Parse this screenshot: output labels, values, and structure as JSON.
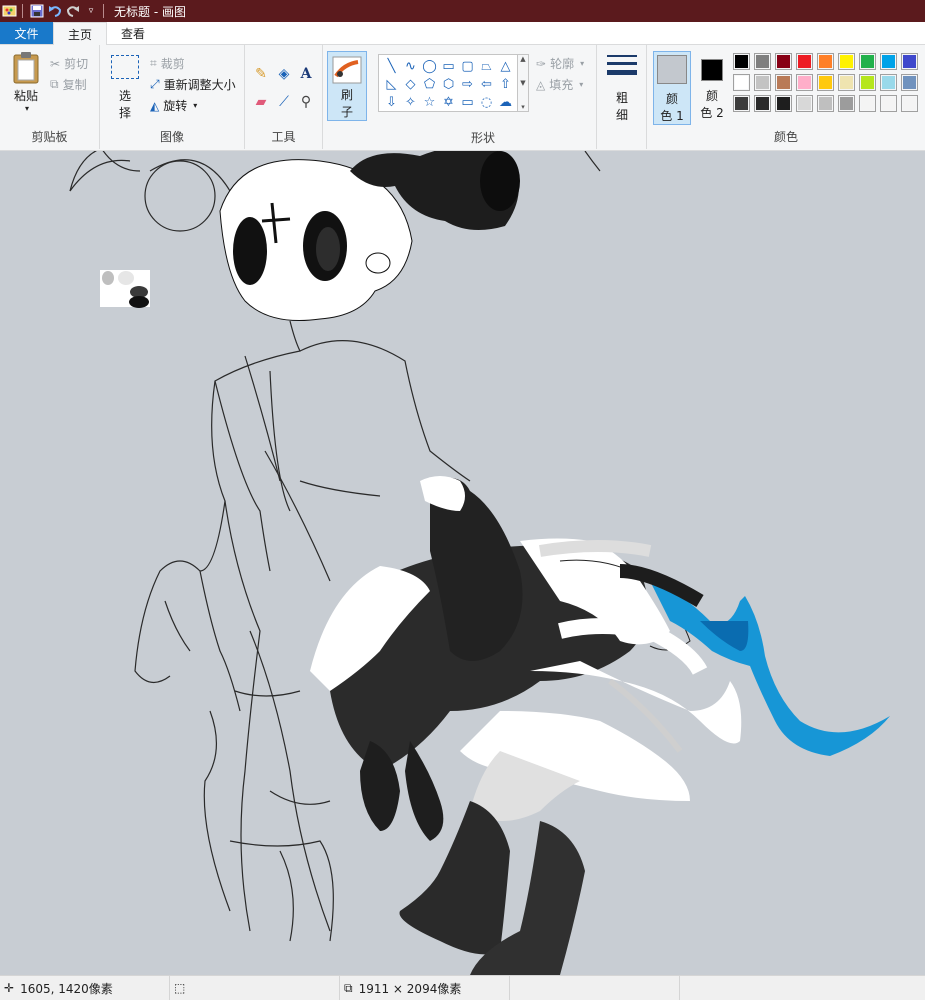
{
  "titlebar": {
    "title": "无标题 - 画图",
    "bg_color": "#5b1a1d"
  },
  "tabs": [
    {
      "label": "文件"
    },
    {
      "label": "主页"
    },
    {
      "label": "查看"
    }
  ],
  "ribbon": {
    "clipboard": {
      "label": "剪贴板",
      "paste": "粘贴",
      "cut": "剪切",
      "copy": "复制"
    },
    "image": {
      "label": "图像",
      "select_line1": "选",
      "select_line2": "择",
      "crop": "裁剪",
      "resize": "重新调整大小",
      "rotate": "旋转"
    },
    "tools": {
      "label": "工具"
    },
    "brushes": {
      "line1": "刷",
      "line2": "子"
    },
    "shapes": {
      "label": "形状",
      "outline": "轮廓",
      "fill": "填充"
    },
    "size": {
      "line1": "粗",
      "line2": "细"
    },
    "colors": {
      "label": "颜色",
      "color1_line1": "颜",
      "color1_line2": "色 1",
      "color2_line1": "颜",
      "color2_line2": "色 2",
      "color1_value": "#c3c8ce",
      "color2_value": "#000000",
      "palette_row1": [
        "#000000",
        "#7f7f7f",
        "#880015",
        "#ed1c24",
        "#ff7f27",
        "#fff200",
        "#22b14c",
        "#00a2e8",
        "#3f48cc"
      ],
      "palette_row2": [
        "#ffffff",
        "#c3c3c3",
        "#b97a57",
        "#ffaec9",
        "#ffc90e",
        "#efe4b0",
        "#b5e61d",
        "#99d9ea",
        "#7092be"
      ],
      "palette_row3": [
        "#3c3c3c",
        "#2a2a2a",
        "#1e1e1e",
        "#d8d8d8",
        "#bfbfbf",
        "#9c9c9c",
        "#f4f4f4",
        "#f4f4f4",
        "#f4f4f4"
      ]
    }
  },
  "statusbar": {
    "cursor_position": "1605, 1420像素",
    "image_size": "1911 × 2094像素"
  }
}
